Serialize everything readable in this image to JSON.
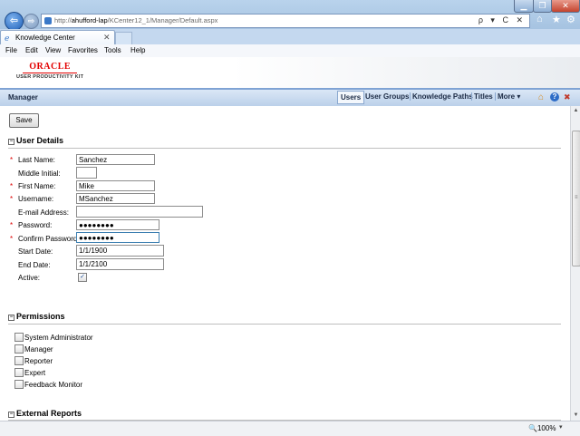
{
  "browser": {
    "url_prefix": "http://",
    "url_host": "ahufford-lap",
    "url_path": "/KCenter12_1/Manager/Default.aspx",
    "address_tools": "ρ ▾ C ✕",
    "tab_title": "Knowledge Center",
    "menu": [
      "File",
      "Edit",
      "View",
      "Favorites",
      "Tools",
      "Help"
    ],
    "zoom": "100%"
  },
  "header": {
    "brand": "ORACLE",
    "product": "USER PRODUCTIVITY KIT",
    "section_title": "Manager",
    "tabs": {
      "users": "Users",
      "user_groups": "User Groups",
      "knowledge_paths": "Knowledge Paths",
      "titles": "Titles",
      "more": "More ▾"
    }
  },
  "toolbar": {
    "save_label": "Save"
  },
  "user_details": {
    "heading": "User Details",
    "last_name_label": "Last Name:",
    "last_name_value": "Sanchez",
    "middle_initial_label": "Middle Initial:",
    "middle_initial_value": "",
    "first_name_label": "First Name:",
    "first_name_value": "Mike",
    "username_label": "Username:",
    "username_value": "MSanchez",
    "email_label": "E-mail Address:",
    "email_value": "",
    "password_label": "Password:",
    "password_value": "●●●●●●●●",
    "confirm_password_label": "Confirm Password:",
    "confirm_password_value": "●●●●●●●●",
    "start_date_label": "Start Date:",
    "start_date_value": "1/1/1900",
    "end_date_label": "End Date:",
    "end_date_value": "1/1/2100",
    "active_label": "Active:",
    "active_checked": true,
    "required_mark": "*"
  },
  "permissions": {
    "heading": "Permissions",
    "items": [
      "System Administrator",
      "Manager",
      "Reporter",
      "Expert",
      "Feedback Monitor"
    ]
  },
  "external_reports": {
    "heading": "External Reports"
  }
}
